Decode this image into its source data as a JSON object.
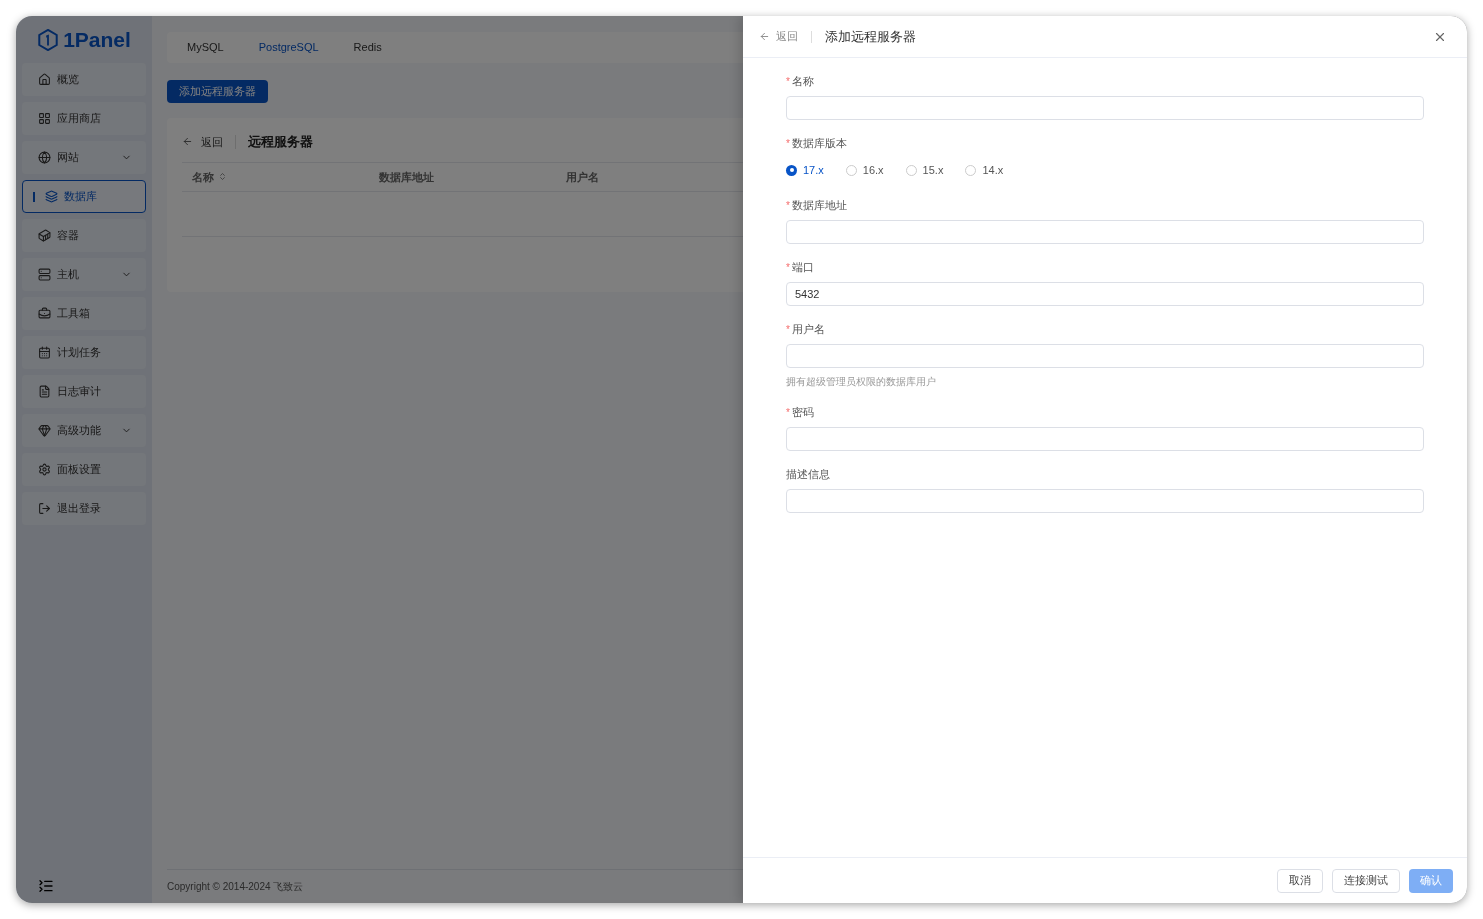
{
  "logo": {
    "text": "1Panel"
  },
  "sidebar": {
    "items": [
      {
        "label": "概览",
        "selected": false,
        "has_submenu": false
      },
      {
        "label": "应用商店",
        "selected": false,
        "has_submenu": false
      },
      {
        "label": "网站",
        "selected": false,
        "has_submenu": true
      },
      {
        "label": "数据库",
        "selected": true,
        "has_submenu": false
      },
      {
        "label": "容器",
        "selected": false,
        "has_submenu": false
      },
      {
        "label": "主机",
        "selected": false,
        "has_submenu": true
      },
      {
        "label": "工具箱",
        "selected": false,
        "has_submenu": false
      },
      {
        "label": "计划任务",
        "selected": false,
        "has_submenu": false
      },
      {
        "label": "日志审计",
        "selected": false,
        "has_submenu": false
      },
      {
        "label": "高级功能",
        "selected": false,
        "has_submenu": true
      },
      {
        "label": "面板设置",
        "selected": false,
        "has_submenu": false
      },
      {
        "label": "退出登录",
        "selected": false,
        "has_submenu": false
      }
    ]
  },
  "tabs": [
    {
      "label": "MySQL",
      "selected": false
    },
    {
      "label": "PostgreSQL",
      "selected": true
    },
    {
      "label": "Redis",
      "selected": false
    }
  ],
  "add_button": "添加远程服务器",
  "card": {
    "back": "返回",
    "title": "远程服务器",
    "table": {
      "columns": [
        {
          "label": "名称",
          "sortable": true
        },
        {
          "label": "数据库地址",
          "sortable": false
        },
        {
          "label": "用户名",
          "sortable": false
        }
      ]
    }
  },
  "footer": "Copyright © 2014-2024 飞致云",
  "drawer": {
    "back": "返回",
    "title": "添加远程服务器",
    "fields": [
      {
        "kind": "input",
        "required_mark": "*",
        "label": "名称"
      },
      {
        "kind": "radio",
        "required_mark": "*",
        "label": "数据库版本",
        "options": [
          {
            "label": "17.x",
            "selected": true
          },
          {
            "label": "16.x",
            "selected": false
          },
          {
            "label": "15.x",
            "selected": false
          },
          {
            "label": "14.x",
            "selected": false
          }
        ]
      },
      {
        "kind": "input",
        "required_mark": "*",
        "label": "数据库地址"
      },
      {
        "kind": "input",
        "required_mark": "*",
        "label": "端口",
        "value": "5432"
      },
      {
        "kind": "input",
        "required_mark": "*",
        "label": "用户名",
        "hint": "拥有超级管理员权限的数据库用户"
      },
      {
        "kind": "input",
        "required_mark": "*",
        "label": "密码"
      },
      {
        "kind": "input",
        "label": "描述信息"
      }
    ],
    "buttons": [
      {
        "label": "取消",
        "kind": "default",
        "disabled": false
      },
      {
        "label": "连接测试",
        "kind": "default",
        "disabled": false
      },
      {
        "label": "确认",
        "kind": "primary",
        "disabled": true
      }
    ]
  }
}
